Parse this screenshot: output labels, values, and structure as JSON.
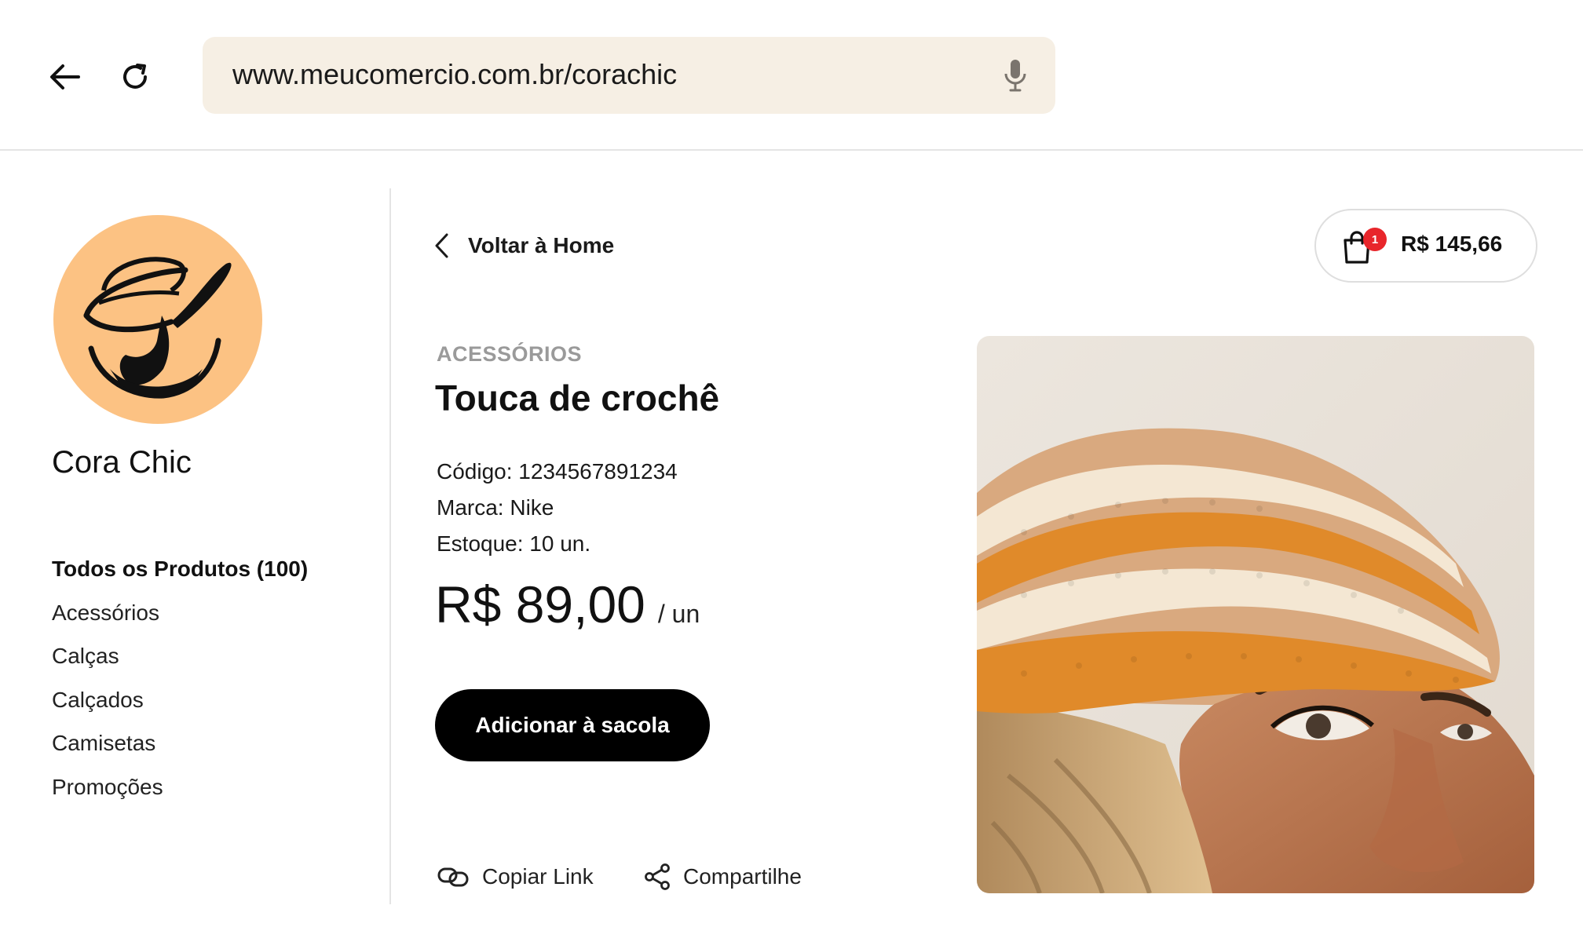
{
  "browser": {
    "url": "www.meucomercio.com.br/corachic"
  },
  "store": {
    "name": "Cora Chic"
  },
  "sidebar": {
    "categories": [
      {
        "label": "Todos os Produtos (100)",
        "active": true
      },
      {
        "label": "Acessórios"
      },
      {
        "label": "Calças"
      },
      {
        "label": "Calçados"
      },
      {
        "label": "Camisetas"
      },
      {
        "label": "Promoções"
      }
    ]
  },
  "header": {
    "back_label": "Voltar à Home",
    "cart_count": "1",
    "cart_total": "R$ 145,66"
  },
  "product": {
    "category": "ACESSÓRIOS",
    "title": "Touca de crochê",
    "code": "Código: 1234567891234",
    "brand": "Marca: Nike",
    "stock": "Estoque: 10 un.",
    "price": "R$ 89,00",
    "unit": "/ un",
    "add_to_bag_label": "Adicionar à sacola"
  },
  "actions": {
    "copy_link_label": "Copiar Link",
    "share_label": "Compartilhe"
  },
  "icons": {
    "back": "arrow-left-icon",
    "reload": "reload-icon",
    "mic": "microphone-icon",
    "chevron": "chevron-left-icon",
    "cart": "shopping-bag-icon",
    "copy": "link-icon",
    "share": "share-icon"
  },
  "colors": {
    "avatar_bg": "#fcc283",
    "address_bar_bg": "#f6efe4",
    "badge": "#e8262b",
    "button_bg": "#000000",
    "category_label": "#9a9a9a"
  }
}
